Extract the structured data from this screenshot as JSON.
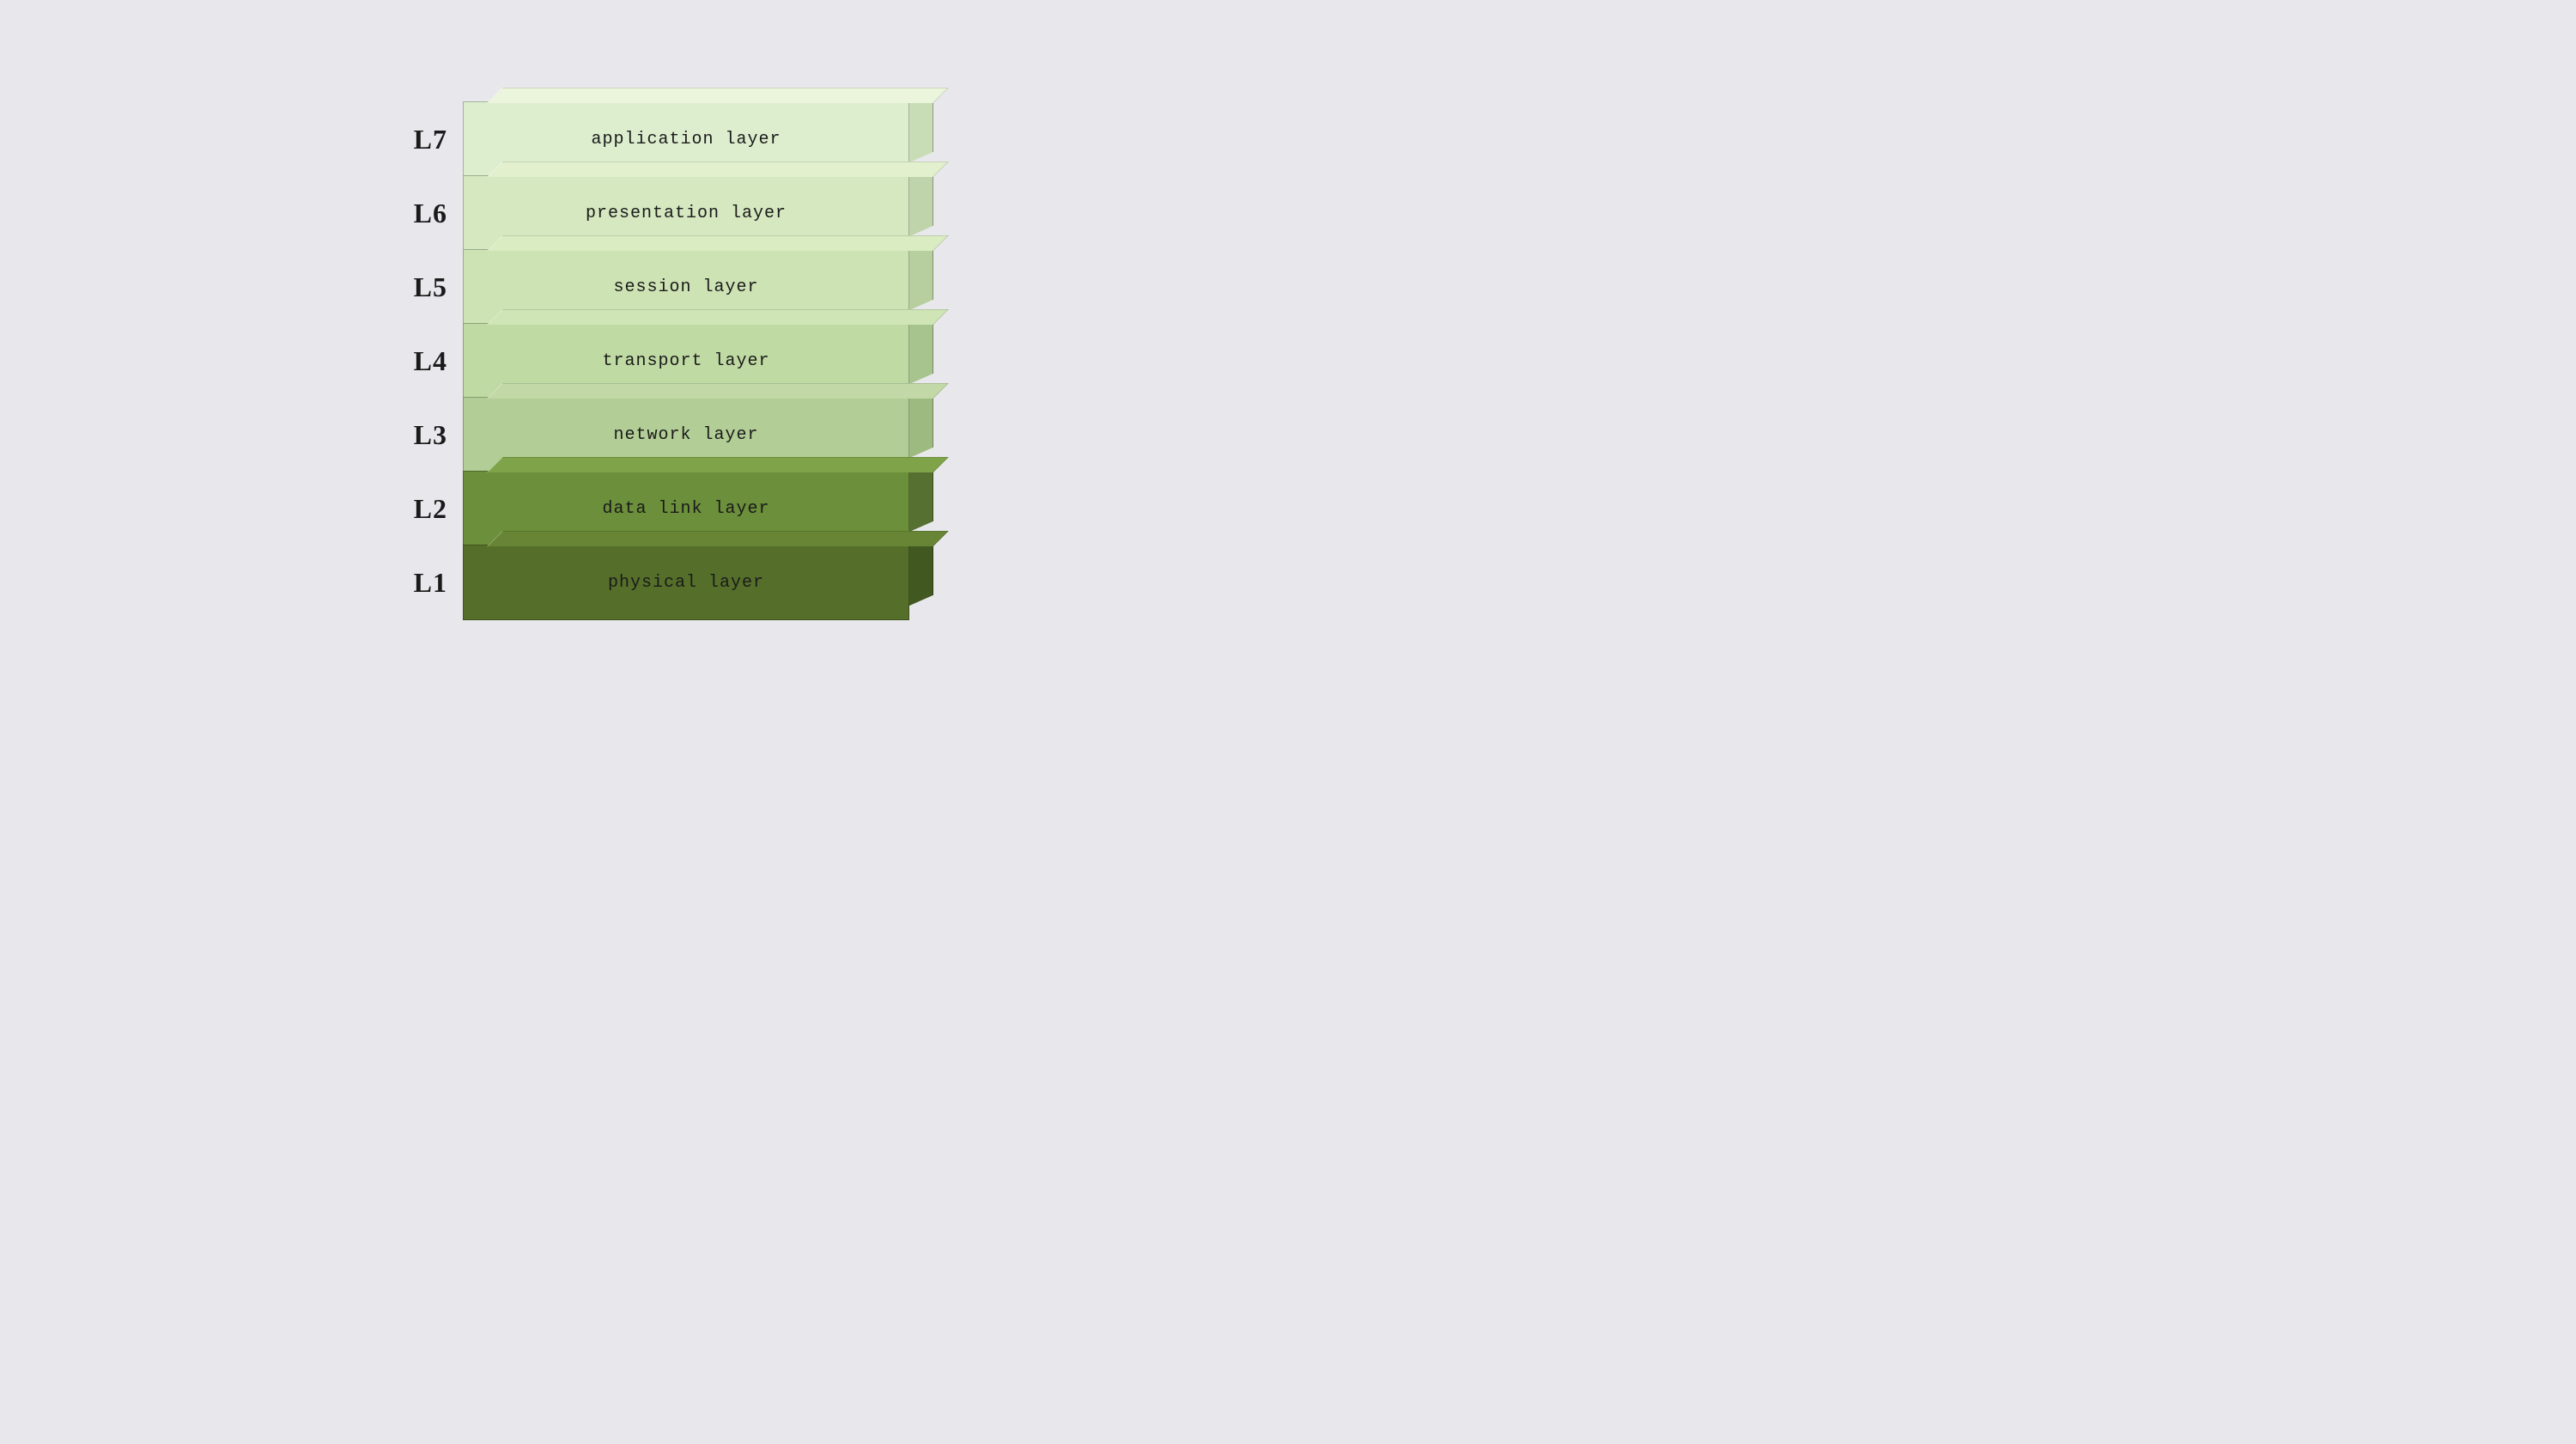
{
  "layers": [
    {
      "id": "layer-7",
      "label": "L7",
      "name": "application layer",
      "colorClass": "layer-7"
    },
    {
      "id": "layer-6",
      "label": "L6",
      "name": "presentation layer",
      "colorClass": "layer-6"
    },
    {
      "id": "layer-5",
      "label": "L5",
      "name": "session layer",
      "colorClass": "layer-5"
    },
    {
      "id": "layer-4",
      "label": "L4",
      "name": "transport layer",
      "colorClass": "layer-4"
    },
    {
      "id": "layer-3",
      "label": "L3",
      "name": "network layer",
      "colorClass": "layer-3"
    },
    {
      "id": "layer-2",
      "label": "L2",
      "name": "data link layer",
      "colorClass": "layer-2"
    },
    {
      "id": "layer-1",
      "label": "L1",
      "name": "physical layer",
      "colorClass": "layer-1"
    }
  ]
}
